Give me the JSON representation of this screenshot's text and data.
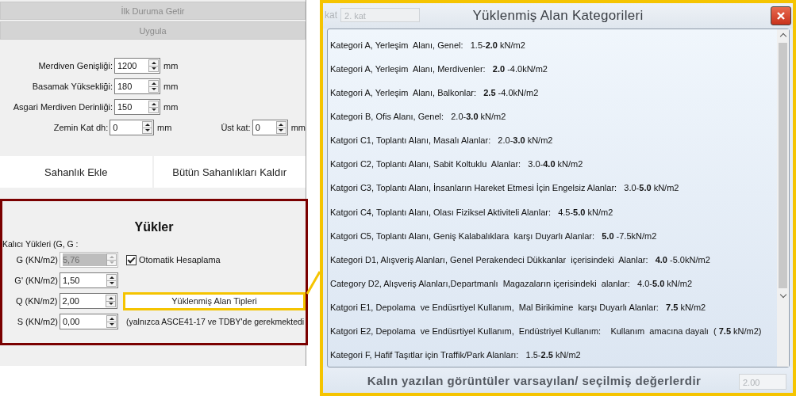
{
  "left_panel": {
    "top_buttons": [
      {
        "label": "İlk Duruma Getir",
        "disabled": true
      },
      {
        "label": "Uygula",
        "disabled": true
      }
    ],
    "fields": [
      {
        "label": "Merdiven Genişliği:",
        "value": "1200",
        "unit": "mm"
      },
      {
        "label": "Basamak Yüksekliği:",
        "value": "180",
        "unit": "mm"
      },
      {
        "label": "Asgari Merdiven Derinliği:",
        "value": "150",
        "unit": "mm"
      },
      {
        "label": "Zemin Kat dh:",
        "value": "0",
        "unit": "mm",
        "extra": {
          "label": "Üst kat:",
          "value": "0",
          "unit": "mm"
        }
      }
    ],
    "landing_buttons": [
      "Sahanlık Ekle",
      "Bütün Sahanlıkları Kaldır"
    ],
    "loads": {
      "title": "Yükler",
      "permanent_label": "Kalıcı Yükleri (G, G :",
      "rows": [
        {
          "label": "G (KN/m2)",
          "value": "5,76",
          "disabled": true
        },
        {
          "label": "G' (KN/m2)",
          "value": "1,50",
          "disabled": false
        },
        {
          "label": "Q (KN/m2)",
          "value": "2,00",
          "disabled": false
        },
        {
          "label": "S (KN/m2)",
          "value": "0,00",
          "disabled": false
        }
      ],
      "auto_checkbox": {
        "label": "Otomatik Hesaplama",
        "checked": true
      },
      "area_types_button": "Yüklenmiş Alan Tipleri",
      "note": "(yalnızca ASCE41-17 ve TDBY'de gerekmektedi"
    }
  },
  "popup": {
    "title": "Yüklenmiş Alan Kategorileri",
    "background_toolbar": {
      "label": "kat",
      "combo": "2. kat"
    },
    "items": [
      "Kategori A, Yerleşim  Alanı, Genel:   1.5-**2.0** kN/m2",
      "Kategori A, Yerleşim  Alanı, Merdivenler:   **2.0** -4.0kN/m2",
      "Kategori A, Yerleşim  Alanı, Balkonlar:   **2.5** -4.0kN/m2",
      "Kategori B, Ofis Alanı, Genel:   2.0-**3.0** kN/m2",
      "Katgori C1, Toplantı Alanı, Masalı Alanlar:   2.0-**3.0** kN/m2",
      "Katgori C2, Toplantı Alanı, Sabit Koltuklu  Alanlar:   3.0-**4.0** kN/m2",
      "Katgori C3, Toplantı Alanı, İnsanların Hareket Etmesi İçin Engelsiz Alanlar:   3.0-**5.0** kN/m2",
      "Katgori C4, Toplantı Alanı, Olası Fiziksel Aktiviteli Alanlar:   4.5-**5.0** kN/m2",
      "Katgori C5, Toplantı Alanı, Geniş Kalabalıklara  karşı Duyarlı Alanlar:   **5.0** -7.5kN/m2",
      "Kategori D1, Alışveriş Alanları, Genel Perakendeci Dükkanlar  içerisindeki  Alanlar:   **4.0** -5.0kN/m2",
      "Category D2, Alışveriş Alanları,Departmanlı  Magazaların içerisindeki  alanlar:   4.0-**5.0** kN/m2",
      "Katgori E1, Depolama  ve Endüsrtiyel Kullanım,  Mal Birikimine  karşı Duyarlı Alanlar:   **7.5** kN/m2",
      "Katgori E2, Depolama  ve Endüsrtiyel Kullanım,  Endüstriyel Kullanım:    Kullanım  amacına dayalı  ( **7.5** kN/m2)",
      "Kategori F, Hafif Taşıtlar için Traffik/Park Alanları:   1.5-**2.5** kN/m2"
    ],
    "footer": "Kalın  yazılan  görüntüler varsayılan/ seçilmiş  değerlerdir",
    "background_field": "2.00"
  }
}
